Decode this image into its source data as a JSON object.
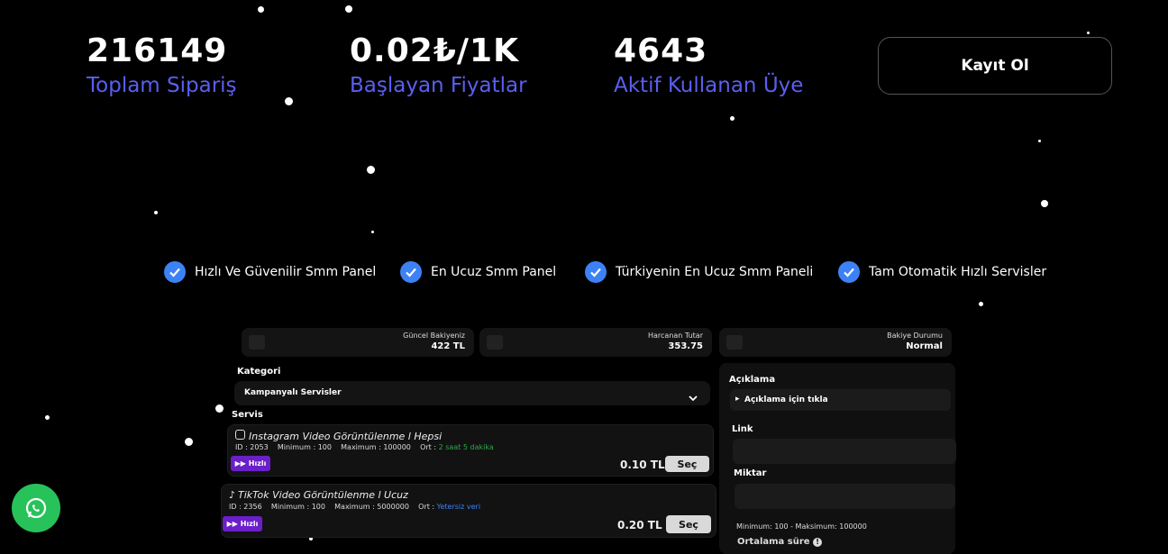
{
  "stats": [
    {
      "value": "216149",
      "label": "Toplam Sipariş"
    },
    {
      "value": "0.02₺/1K",
      "label": "Başlayan Fiyatlar"
    },
    {
      "value": "4643",
      "label": "Aktif Kullanan Üye"
    }
  ],
  "register_label": "Kayıt Ol",
  "features": [
    "Hızlı Ve Güvenilir Smm Panel",
    "En Ucuz Smm Panel",
    "Türkiyenin En Ucuz Smm Paneli",
    "Tam Otomatik Hızlı Servisler"
  ],
  "preview": {
    "balance": {
      "label": "Güncel Bakiyeniz",
      "value": "422 TL"
    },
    "spent": {
      "label": "Harcanan Tutar",
      "value": "353.75"
    },
    "status": {
      "label": "Bakiye Durumu",
      "value": "Normal"
    },
    "kategori_label": "Kategori",
    "kategori_value": "Kampanyalı Servisler",
    "servis_label": "Servis",
    "services": [
      {
        "name": "Instagram Video Görüntülenme l Hepsi",
        "id": "ID : 2053",
        "min": "Minimum : 100",
        "max": "Maximum : 100000",
        "ort_label": "Ort :",
        "ort_value": "2 saat 5 dakika",
        "badge": "Hızlı",
        "price": "0.10 TL",
        "button": "Seç"
      },
      {
        "name": "TikTok Video Görüntülenme l Ucuz",
        "id": "ID : 2356",
        "min": "Minimum : 100",
        "max": "Maximum : 5000000",
        "ort_label": "Ort :",
        "ort_value": "Yetersiz veri",
        "badge": "Hızlı",
        "price": "0.20 TL",
        "button": "Seç"
      }
    ],
    "aciklama_label": "Açıklama",
    "aciklama_toggle": "Açıklama için tıkla",
    "link_label": "Link",
    "miktar_label": "Miktar",
    "limits": "Minimum: 100 - Maksimum: 100000",
    "avg_label": "Ortalama süre"
  },
  "colors": {
    "accent": "#5a5ff0",
    "check": "#3d82f5",
    "badge": "#6a1fc9",
    "whatsapp": "#27c25a",
    "green_text": "#2ea84a",
    "blue_text": "#3d82f5"
  },
  "icons": {
    "check": "check-icon",
    "whatsapp": "whatsapp-icon"
  }
}
